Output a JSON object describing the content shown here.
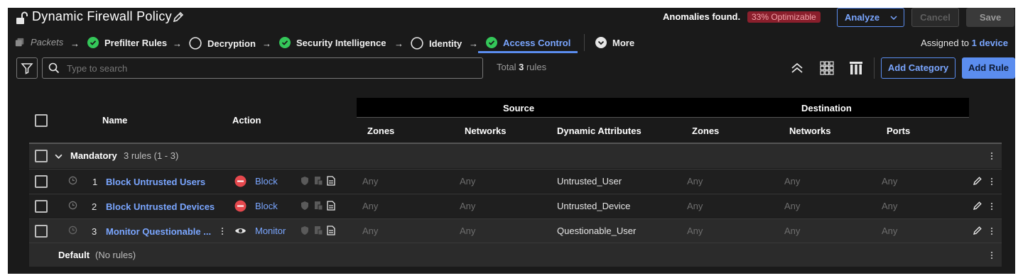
{
  "header": {
    "title": "Dynamic Firewall Policy",
    "anomalies_label": "Anomalies found.",
    "anomalies_badge": "33% Optimizable",
    "analyze_label": "Analyze",
    "cancel_label": "Cancel",
    "save_label": "Save"
  },
  "nav": {
    "items": [
      {
        "label": "Packets",
        "icon": "packets-icon",
        "state": "muted"
      },
      {
        "label": "Prefilter Rules",
        "icon": "check-circle-icon",
        "state": "done"
      },
      {
        "label": "Decryption",
        "icon": "empty-circle-icon",
        "state": "pending"
      },
      {
        "label": "Security Intelligence",
        "icon": "check-circle-icon",
        "state": "done"
      },
      {
        "label": "Identity",
        "icon": "empty-circle-icon",
        "state": "pending"
      },
      {
        "label": "Access Control",
        "icon": "check-circle-icon",
        "state": "active"
      },
      {
        "label": "More",
        "icon": "chevron-circle-icon",
        "state": "menu"
      }
    ],
    "arrow": "→",
    "assigned_prefix": "Assigned to",
    "assigned_link": "1 device"
  },
  "toolbar": {
    "search_placeholder": "Type to search",
    "total_prefix": "Total",
    "total_count": "3",
    "total_suffix": "rules",
    "add_category_label": "Add Category",
    "add_rule_label": "Add Rule"
  },
  "table": {
    "columns": {
      "name": "Name",
      "action": "Action",
      "source_group": "Source",
      "destination_group": "Destination",
      "src_zones": "Zones",
      "src_networks": "Networks",
      "dyn_attrs": "Dynamic Attributes",
      "dst_zones": "Zones",
      "dst_networks": "Networks",
      "ports": "Ports"
    },
    "mandatory": {
      "label": "Mandatory",
      "count": "3 rules (1 - 3)"
    },
    "rules": [
      {
        "num": "1",
        "name": "Block Untrusted Users",
        "action": "Block",
        "action_icon": "block-icon",
        "src_zones": "Any",
        "src_networks": "Any",
        "dyn_attr": "Untrusted_User",
        "dst_zones": "Any",
        "dst_networks": "Any",
        "ports": "Any"
      },
      {
        "num": "2",
        "name": "Block Untrusted Devices",
        "action": "Block",
        "action_icon": "block-icon",
        "src_zones": "Any",
        "src_networks": "Any",
        "dyn_attr": "Untrusted_Device",
        "dst_zones": "Any",
        "dst_networks": "Any",
        "ports": "Any"
      },
      {
        "num": "3",
        "name": "Monitor Questionable ...",
        "action": "Monitor",
        "action_icon": "eye-icon",
        "src_zones": "Any",
        "src_networks": "Any",
        "dyn_attr": "Questionable_User",
        "dst_zones": "Any",
        "dst_networks": "Any",
        "ports": "Any"
      }
    ],
    "default": {
      "label": "Default",
      "count": "(No rules)"
    }
  },
  "colors": {
    "accent": "#5b8def",
    "link": "#7aa6ff",
    "success": "#34c759",
    "danger": "#e5484d",
    "badge_bg": "#8a1f2c"
  }
}
